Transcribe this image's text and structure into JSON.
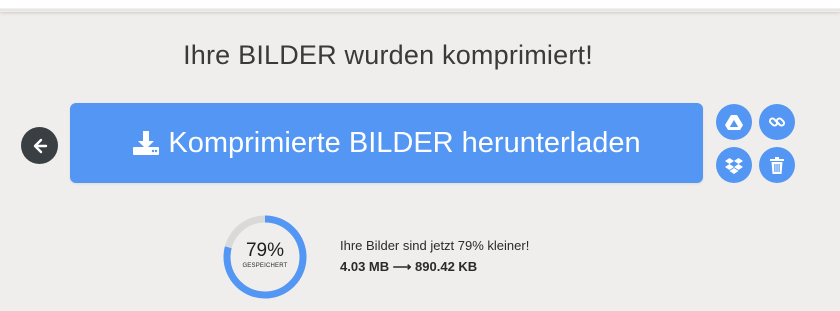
{
  "header": {
    "title": "Ihre BILDER wurden komprimiert!"
  },
  "actions": {
    "download_label": "Komprimierte BILDER herunterladen",
    "back_icon": "arrow-left-icon",
    "download_icon": "download-tray-icon",
    "side_buttons": [
      {
        "icon": "google-drive-icon"
      },
      {
        "icon": "link-icon"
      },
      {
        "icon": "dropbox-icon"
      },
      {
        "icon": "trash-icon"
      }
    ]
  },
  "result": {
    "percent_text": "79%",
    "percent_value": 0.79,
    "saved_label": "GESPEICHERT",
    "message": "Ihre Bilder sind jetzt 79% kleiner!",
    "original_size": "4.03 MB",
    "arrow": "⟶",
    "compressed_size": "890.42 KB"
  },
  "colors": {
    "accent": "#5396f3",
    "back_button": "#3a3f44",
    "background": "#efeeec",
    "ring_track": "#d9d9d9"
  }
}
